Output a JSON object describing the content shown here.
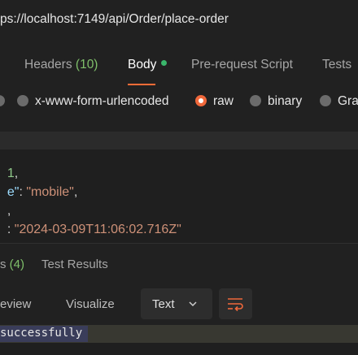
{
  "request": {
    "url": "ps://localhost:7149/api/Order/place-order"
  },
  "request_tabs": [
    {
      "label": "Headers",
      "count": "(10)"
    },
    {
      "label": "Body"
    },
    {
      "label": "Pre-request Script"
    },
    {
      "label": "Tests"
    }
  ],
  "body_types": [
    {
      "label": "x-www-form-urlencoded",
      "selected": false
    },
    {
      "label": "raw",
      "selected": true
    },
    {
      "label": "binary",
      "selected": false
    },
    {
      "label": "Gra",
      "selected": false
    }
  ],
  "editor": {
    "line1": {
      "value": "1",
      "punc": ","
    },
    "line2": {
      "key_end": "e\"",
      "sep": ": ",
      "value": "\"mobile\"",
      "punc": ","
    },
    "line3": {
      "punc": ","
    },
    "line4": {
      "sep": ": ",
      "value": "\"2024-03-09T11:06:02.716Z\""
    }
  },
  "response_tabs": [
    {
      "label": "s",
      "count": "(4)"
    },
    {
      "label": "Test Results"
    }
  ],
  "response_toolbar": {
    "preview": "eview",
    "visualize": "Visualize",
    "format": "Text"
  },
  "response_body": {
    "text": "successfully"
  },
  "colors": {
    "accent": "#ff6c37",
    "active_dot": "#3ab66b",
    "count_green": "#7fbf6a"
  }
}
